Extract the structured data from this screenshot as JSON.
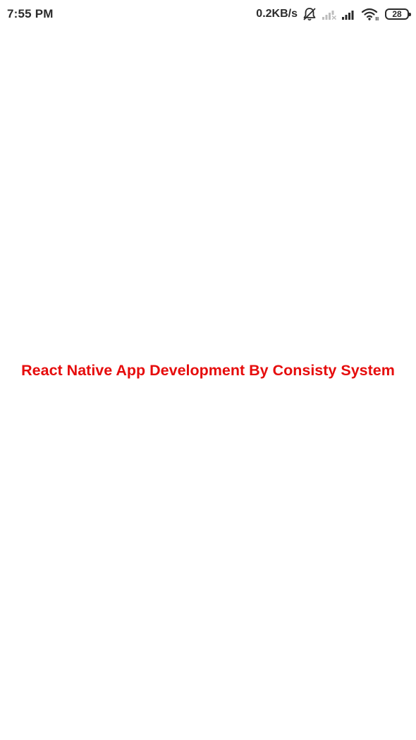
{
  "status_bar": {
    "time": "7:55 PM",
    "net_speed": "0.2KB/s",
    "battery_level": "28",
    "icons": [
      "bell-muted-icon",
      "signal-weak-icon",
      "signal-full-icon",
      "wifi-icon",
      "battery-icon"
    ]
  },
  "main": {
    "headline": "React Native App Development By Consisty System",
    "headline_color": "#e60c0c"
  }
}
